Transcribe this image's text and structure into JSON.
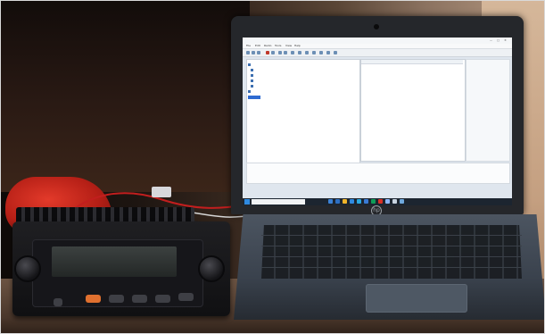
{
  "photo": {
    "subject": "",
    "colors": {
      "accent_red": "#d22a1f",
      "screen_bg": "#dfe6ee",
      "taskbar": "#1c2530",
      "selection": "#2f6bd1",
      "radio_button_orange": "#e0702f"
    }
  },
  "laptop_screen": {
    "window_title": "",
    "window_buttons": [
      "—",
      "□",
      "✕"
    ],
    "menu": [
      "File",
      "Edit",
      "Radio",
      "Tools",
      "View",
      "Help"
    ],
    "tree": [
      "",
      "",
      "",
      "",
      "",
      ""
    ],
    "list_headers": [
      "",
      ""
    ],
    "list_rows": [
      [
        "",
        ""
      ],
      [
        "",
        ""
      ]
    ],
    "status_lines": [
      "",
      ""
    ],
    "taskbar": {
      "search_placeholder": "",
      "clock_time": "",
      "clock_date": ""
    }
  },
  "radio": {
    "brand_label": ""
  },
  "laptop": {
    "logo": "hp"
  }
}
